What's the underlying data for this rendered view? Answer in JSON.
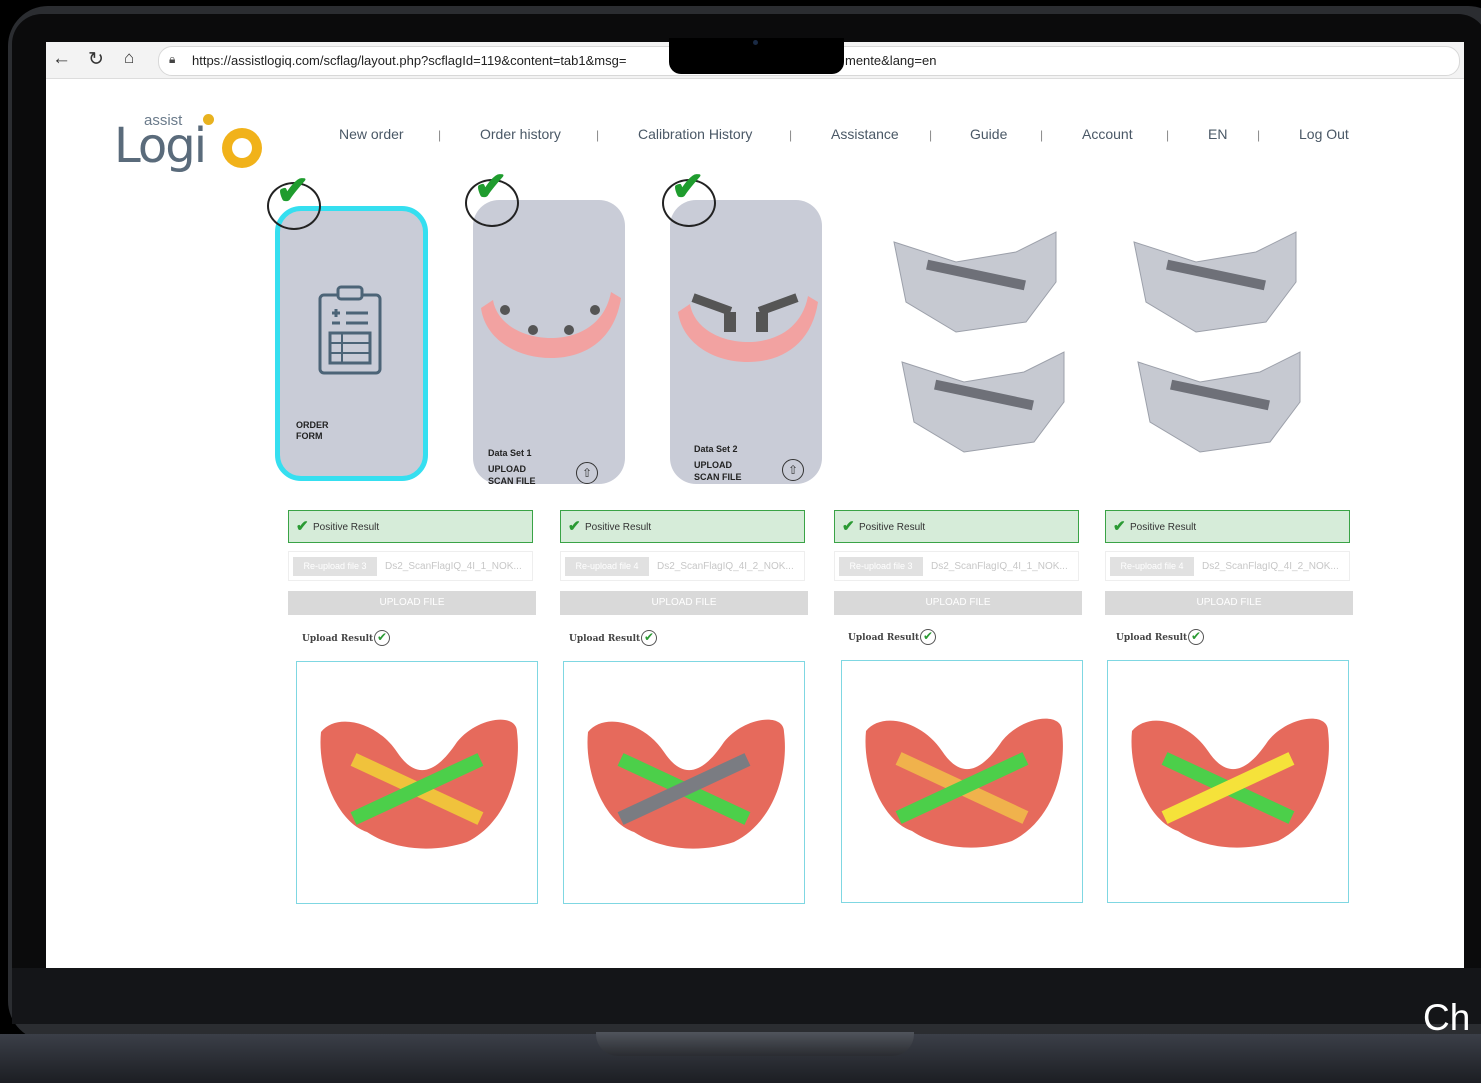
{
  "browser": {
    "url_left": "https://assistlogiq.com/scflag/layout.php?scflagId=119&content=tab1&msg=",
    "url_right": "mente&lang=en"
  },
  "logo": {
    "assist": "assist",
    "logiq": "Logi"
  },
  "menu": [
    "New order",
    "Order history",
    "Calibration History",
    "Assistance",
    "Guide",
    "Account",
    "EN",
    "Log Out"
  ],
  "cards": [
    {
      "title": "ORDER",
      "title2": "FORM"
    },
    {
      "set": "Data Set 1",
      "l1": "UPLOAD",
      "l2": "SCAN FILE"
    },
    {
      "set": "Data Set 2",
      "l1": "UPLOAD",
      "l2": "SCAN FILE"
    }
  ],
  "results": [
    {
      "positive": "Positive Result",
      "reupload": "Re-upload file 3",
      "file": "Ds2_ScanFlagIQ_4I_1_NOK...",
      "upload": "UPLOAD FILE",
      "upload_result": "Upload Result"
    },
    {
      "positive": "Positive Result",
      "reupload": "Re-upload file 4",
      "file": "Ds2_ScanFlagIQ_4I_2_NOK...",
      "upload": "UPLOAD FILE",
      "upload_result": "Upload Result"
    },
    {
      "positive": "Positive Result",
      "reupload": "Re-upload file 3",
      "file": "Ds2_ScanFlagIQ_4I_1_NOK...",
      "upload": "UPLOAD FILE",
      "upload_result": "Upload Result"
    },
    {
      "positive": "Positive Result",
      "reupload": "Re-upload file 4",
      "file": "Ds2_ScanFlagIQ_4I_2_NOK...",
      "upload": "UPLOAD FILE",
      "upload_result": "Upload Result"
    }
  ],
  "overlay_text": "Ch",
  "colors": {
    "accent_cyan": "#35dff0",
    "positive_green": "#2a9a33",
    "card_gray": "#c9ccd7",
    "scan_red": "#e66a5c"
  }
}
